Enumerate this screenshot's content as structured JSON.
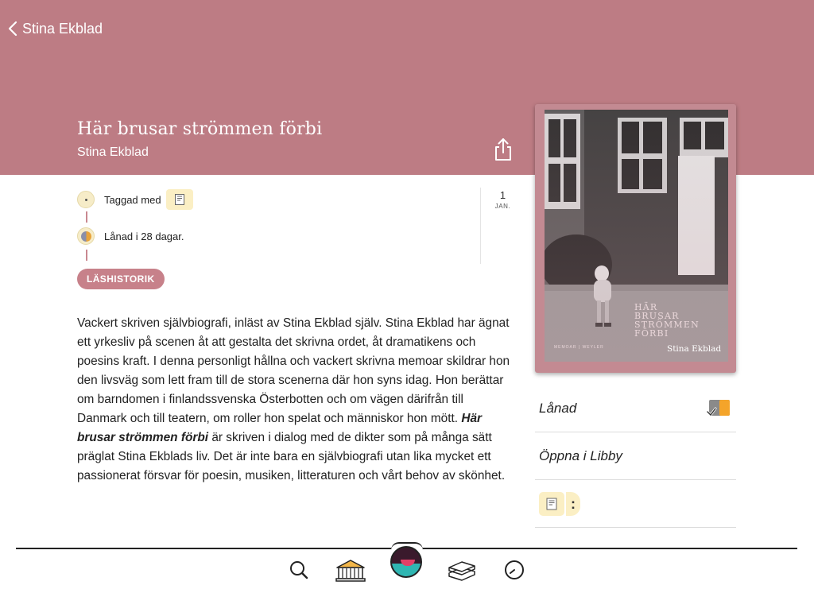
{
  "nav": {
    "back_label": "Stina Ekblad"
  },
  "book": {
    "title": "Här brusar strömmen förbi",
    "author": "Stina Ekblad"
  },
  "timeline": {
    "tagged_label": "Taggad med",
    "loan_label": "Lånad i 28 dagar.",
    "date_day": "1",
    "date_month": "JAN."
  },
  "history_button": "LÄSHISTORIK",
  "description": {
    "part1": "Vackert skriven självbiografi, inläst av Stina Ekblad själv. Stina Ekblad har ägnat ett yrkesliv på scenen åt att gestalta det skrivna ordet, åt dramatikens och poesins kraft. I denna personligt hållna och vackert skrivna memoar skildrar hon den livsväg som lett fram till de stora scenerna där hon syns idag. Hon berättar om barndomen i finlandssvenska Österbotten och om vägen därifrån till Danmark och till teatern, om roller hon spelat och människor hon mött. ",
    "emphasis": "Här brusar strömmen förbi",
    "part2": " är skriven i dialog med de dikter som på många sätt präglat Stina Ekblads liv. Det är inte bara en självbiografi utan lika mycket ett passionerat försvar för poesin, musiken, litteraturen och vårt behov av skönhet."
  },
  "cover": {
    "title_line1": "HÄR",
    "title_line2": "BRUSAR",
    "title_line3": "STRÖMMEN",
    "title_line4": "FÖRBI",
    "publisher": "MEMOAR | WEYLER",
    "author": "Stina Ekblad"
  },
  "actions": {
    "loaned_label": "Lånad",
    "open_libby_label": "Öppna i Libby",
    "more_label": ":"
  },
  "colors": {
    "header": "#bd7c84",
    "accent": "#c7818a",
    "tag_chip": "#fbefc4"
  },
  "icons": {
    "back": "chevron-left-icon",
    "share": "share-icon",
    "tag": "tag-icon",
    "status": "loaned-status-icon",
    "tabs": [
      "search-icon",
      "library-icon",
      "shelf-icon",
      "books-icon",
      "timeline-icon"
    ]
  }
}
